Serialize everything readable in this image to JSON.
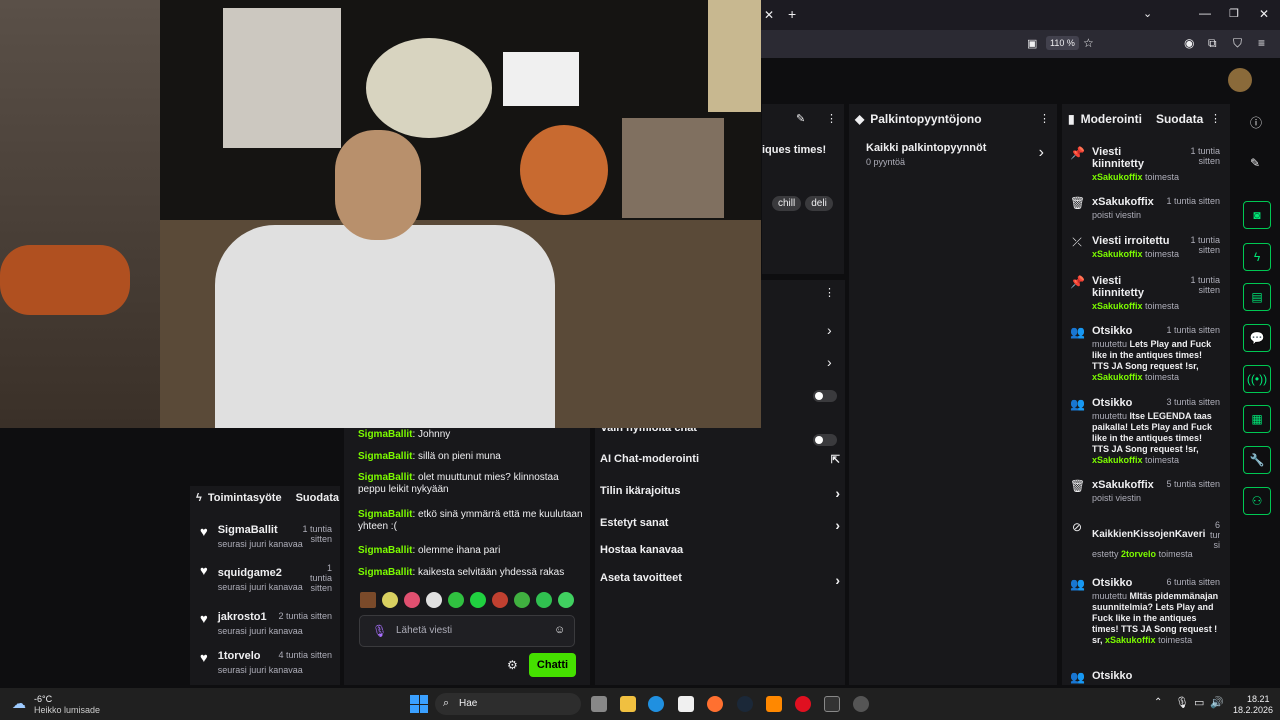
{
  "browser": {
    "zoom": "110 %",
    "colors": {
      "tab_bar": "#1c1b22",
      "url_bar": "#2b2a33"
    }
  },
  "stream_title_fragment": "iques times!",
  "tags": [
    "chill",
    "deli"
  ],
  "reward_queue": {
    "title": "Palkintopyyntöjono",
    "all_label": "Kaikki palkintopyynnöt",
    "count": "0 pyyntöä"
  },
  "moderation": {
    "title": "Moderointi",
    "filter": "Suodata",
    "rows": [
      {
        "icon": "pin-icon",
        "title": "Viesti kiinnitetty",
        "time": "1 tuntia sitten",
        "user": "xSakukoffix",
        "suffix": "toimesta",
        "detail": ""
      },
      {
        "icon": "trash-icon",
        "title": "xSakukoffix",
        "time": "1 tuntia sitten",
        "user": "",
        "suffix": "",
        "detail": "poisti viestin"
      },
      {
        "icon": "unpin-icon",
        "title": "Viesti irroitettu",
        "time": "1 tuntia sitten",
        "user": "xSakukoffix",
        "suffix": "toimesta",
        "detail": ""
      },
      {
        "icon": "pin-icon",
        "title": "Viesti kiinnitetty",
        "time": "1 tuntia sitten",
        "user": "xSakukoffix",
        "suffix": "toimesta",
        "detail": ""
      },
      {
        "icon": "users-icon",
        "title": "Otsikko",
        "time": "1 tuntia sitten",
        "user": "xSakukoffix",
        "suffix": "toimesta",
        "detail": "muutettu",
        "bold": "Lets Play and Fuck like in the antiques times! TTS JA Song request !sr,"
      },
      {
        "icon": "users-icon",
        "title": "Otsikko",
        "time": "3 tuntia sitten",
        "user": "xSakukoffix",
        "suffix": "toimesta",
        "detail": "muutettu",
        "bold": "Itse LEGENDA taas paikalla! Lets Play and Fuck like in the antiques times! TTS JA Song request !sr,"
      },
      {
        "icon": "trash-icon",
        "title": "xSakukoffix",
        "time": "5 tuntia sitten",
        "user": "",
        "suffix": "",
        "detail": "poisti viestin"
      },
      {
        "icon": "ban-icon",
        "title": "KaikkienKissojenKaveri",
        "time": "6 tuntia si",
        "user": "2torvelo",
        "suffix": "toimesta",
        "detail": "estetty"
      },
      {
        "icon": "users-icon",
        "title": "Otsikko",
        "time": "6 tuntia sitten",
        "user": "xSakukoffix",
        "suffix": "toimesta",
        "detail": "muutettu",
        "bold": "MItäs pidemmänajan suunnitelmia? Lets Play and Fuck like in the antiques times! TTS JA Song request ! sr,"
      },
      {
        "icon": "users-icon",
        "title": "Otsikko",
        "time": "",
        "user": "",
        "suffix": "",
        "detail": ""
      }
    ]
  },
  "activity": {
    "title": "Toimintasyöte",
    "filter": "Suodata",
    "rows": [
      {
        "name": "SigmaBallit",
        "time": "1 tuntia sitten",
        "sub": "seurasi juuri kanavaa"
      },
      {
        "name": "squidgame2",
        "time": "1 tuntia sitten",
        "sub": "seurasi juuri kanavaa"
      },
      {
        "name": "jakrosto1",
        "time": "2 tuntia sitten",
        "sub": "seurasi juuri kanavaa"
      },
      {
        "name": "1torvelo",
        "time": "4 tuntia sitten",
        "sub": "seurasi juuri kanavaa"
      }
    ]
  },
  "chat": {
    "messages": [
      {
        "user": "SigmaBallit",
        "text": "Johnny"
      },
      {
        "user": "SigmaBallit",
        "text": "sillä on pieni muna"
      },
      {
        "user": "SigmaBallit",
        "text": "olet muuttunut mies? klinnostaa peppu leikit nykyään"
      },
      {
        "user": "SigmaBallit",
        "text": "etkö sinä ymmärrä että me kuulutaan yhteen :("
      },
      {
        "user": "SigmaBallit",
        "text": "olemme ihana pari"
      },
      {
        "user": "SigmaBallit",
        "text": "kaikesta selvitään yhdessä rakas"
      }
    ],
    "placeholder": "Lähetä viesti",
    "send_label": "Chatti"
  },
  "settings": {
    "partial": "vain hymiöitä chat",
    "rows": [
      "AI Chat-moderointi",
      "Tilin ikärajoitus",
      "Estetyt sanat",
      "Hostaa kanavaa",
      "Aseta tavoitteet"
    ]
  },
  "taskbar": {
    "weather_temp": "-6°C",
    "weather_desc": "Heikko lumisade",
    "search": "Hae",
    "time": "18.21",
    "date": "18.2.2026"
  }
}
